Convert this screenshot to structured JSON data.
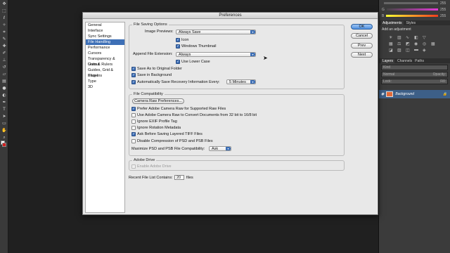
{
  "app": {
    "window_title": "Preferences"
  },
  "toolbar_tools": [
    "move-icon",
    "marquee-icon",
    "lasso-icon",
    "wand-icon",
    "crop-icon",
    "eyedropper-icon",
    "heal-icon",
    "brush-icon",
    "stamp-icon",
    "history-brush-icon",
    "eraser-icon",
    "gradient-icon",
    "blur-icon",
    "dodge-icon",
    "pen-icon",
    "type-icon",
    "path-select-icon",
    "shape-icon",
    "hand-icon",
    "zoom-icon"
  ],
  "right_panel": {
    "color_rows": [
      {
        "label": "G",
        "value": "255",
        "color": "#e23ad6"
      },
      {
        "label": "B",
        "value": "255",
        "color": "#f13c1e"
      }
    ],
    "top_value": "255",
    "adjustments_tab": "Adjustments",
    "styles_tab": "Styles",
    "add_adjustment": "Add an adjustment",
    "layers_tabs": [
      "Layers",
      "Channels",
      "Paths"
    ],
    "kind_label": "Kind",
    "blend_mode": "Normal",
    "opacity_label": "Opacity:",
    "lock_label": "Lock:",
    "fill_label": "Fill:",
    "layer_name": "Background"
  },
  "categories": [
    "General",
    "Interface",
    "Sync Settings",
    "File Handling",
    "Performance",
    "Cursors",
    "Transparency & Gamut",
    "Units & Rulers",
    "Guides, Grid & Slices",
    "Plug-Ins",
    "Type",
    "3D"
  ],
  "selected_category": "File Handling",
  "file_saving": {
    "title": "File Saving Options",
    "image_previews_label": "Image Previews:",
    "image_previews_value": "Always Save",
    "icon_label": "Icon",
    "windows_thumbnail_label": "Windows Thumbnail",
    "append_ext_label": "Append File Extension:",
    "append_ext_value": "Always",
    "use_lower_case_label": "Use Lower Case",
    "save_as_original_label": "Save As to Original Folder",
    "save_in_background_label": "Save in Background",
    "auto_save_label": "Automatically Save Recovery Information Every:",
    "auto_save_value": "5 Minutes"
  },
  "file_compat": {
    "title": "File Compatibility",
    "camera_raw_button": "Camera Raw Preferences...",
    "options": [
      {
        "label": "Prefer Adobe Camera Raw for Supported Raw Files",
        "checked": true
      },
      {
        "label": "Use Adobe Camera Raw to Convert Documents from 32 bit to 16/8 bit",
        "checked": false
      },
      {
        "label": "Ignore EXIF Profile Tag",
        "checked": false
      },
      {
        "label": "Ignore Rotation Metadata",
        "checked": false
      },
      {
        "label": "Ask Before Saving Layered TIFF Files",
        "checked": true
      },
      {
        "label": "Disable Compression of PSD and PSB Files",
        "checked": false
      }
    ],
    "maximize_label": "Maximize PSD and PSB File Compatibility:",
    "maximize_value": "Ask"
  },
  "adobe_drive": {
    "title": "Adobe Drive",
    "enable_label": "Enable Adobe Drive"
  },
  "recent_files": {
    "label": "Recent File List Contains:",
    "value": "20",
    "suffix": "files"
  },
  "buttons": {
    "ok": "OK",
    "cancel": "Cancel",
    "prev": "Prev",
    "next": "Next"
  },
  "accent_color": "#3d6fb6"
}
